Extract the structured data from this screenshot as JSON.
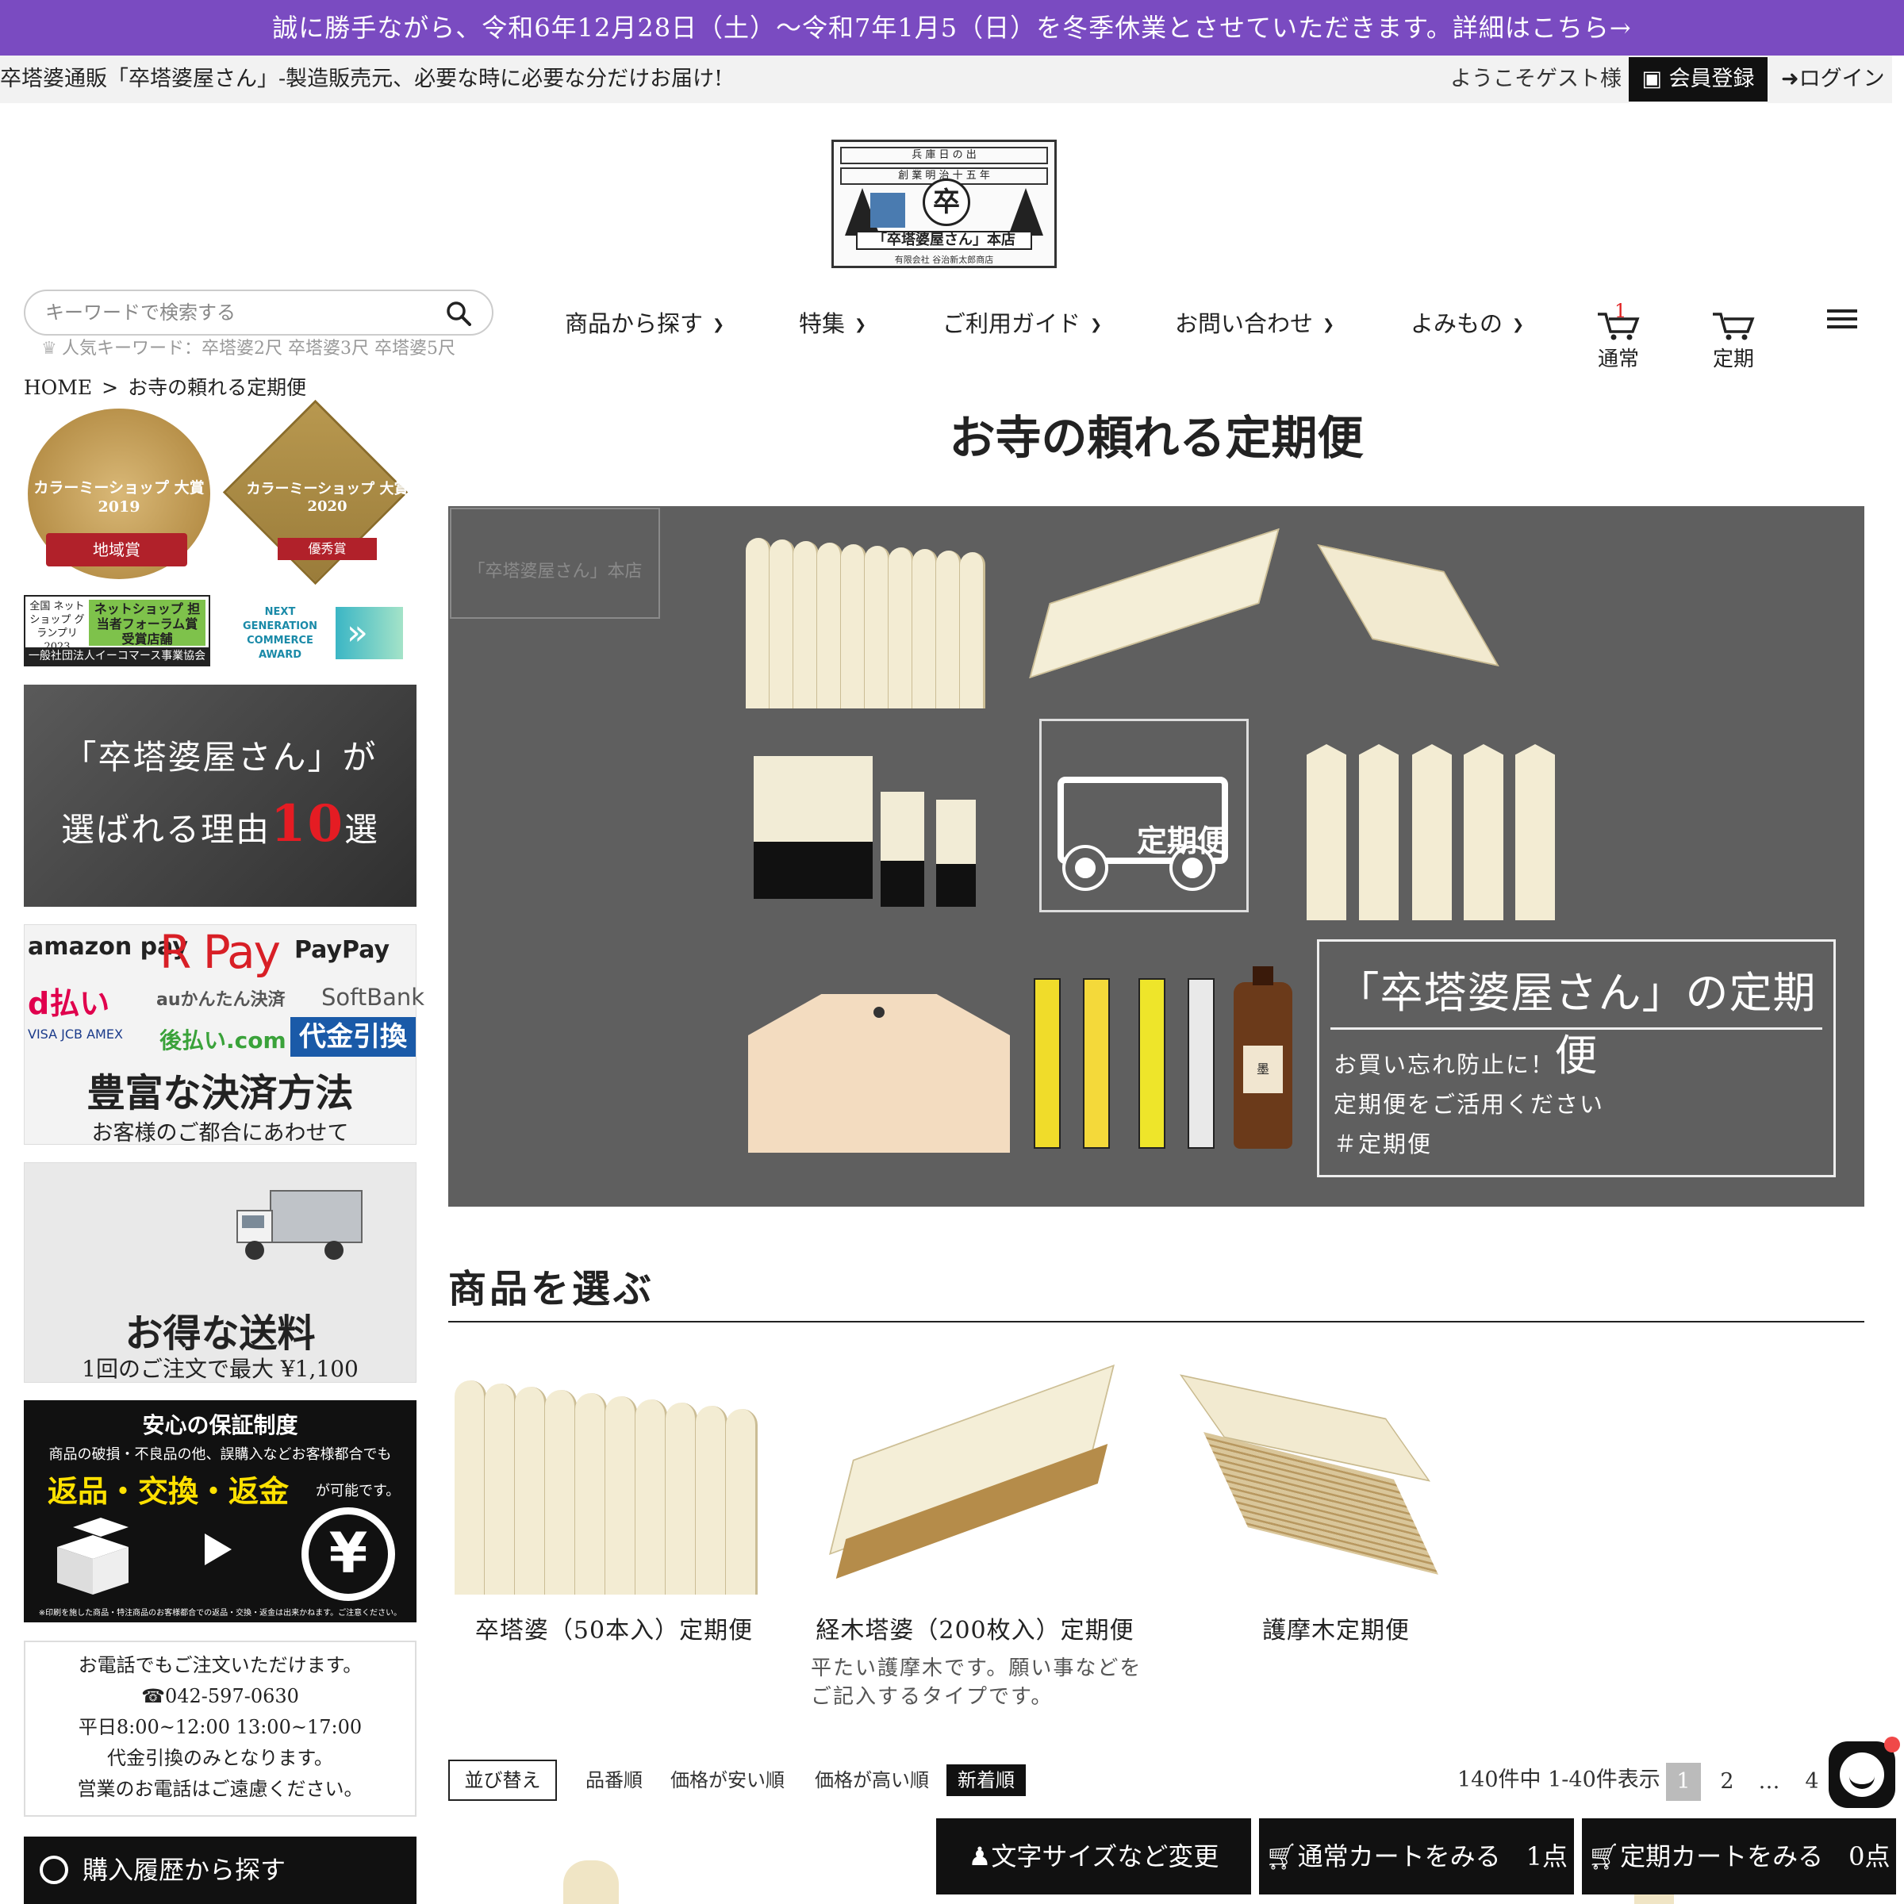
{
  "announcement": "誠に勝手ながら、令和6年12月28日（土）〜令和7年1月5（日）を冬季休業とさせていただきます。詳細はこちら→",
  "utilbar": {
    "tagline": "卒塔婆通販「卒塔婆屋さん」-製造販売元、必要な時に必要な分だけお届け!",
    "welcome": "ようこそゲスト様",
    "register": "会員登録",
    "login": "ログイン"
  },
  "logo": {
    "line1": "兵 庫 日 の 出",
    "line2": "創 業 明 治 十 五 年",
    "mark": "卒",
    "name": "「卒塔婆屋さん」本店",
    "company": "有限会社 谷治新太郎商店"
  },
  "search": {
    "placeholder": "キーワードで検索する",
    "popular_label": "人気キーワード：",
    "popular_keywords": "卒塔婆2尺 卒塔婆3尺 卒塔婆5尺"
  },
  "nav": {
    "items": [
      "商品から探す",
      "特集",
      "ご利用ガイド",
      "お問い合わせ",
      "よみもの"
    ],
    "cart_normal": "通常",
    "cart_normal_count": "1",
    "cart_subscription": "定期"
  },
  "breadcrumb": {
    "home": "HOME",
    "sep": ">",
    "current": "お寺の頼れる定期便"
  },
  "sidebar": {
    "award1_title": "カラーミーショップ 大賞2019",
    "award1_ribbon": "地域賞",
    "award2_title": "カラーミーショップ 大賞2020",
    "award2_ribbon": "優秀賞",
    "grandprix_left": "全国 ネットショップ グランプリ 2023",
    "grandprix_right": "ネットショップ 担当者フォーラム賞 受賞店舗",
    "grandprix_bottom": "一般社団法人イーコマース事業協会",
    "nextgen": "NEXT GENERATION COMMERCE AWARD",
    "reason_line1": "「卒塔婆屋さん」が",
    "reason_line2_pre": "選ばれる理由",
    "reason_num": "10",
    "reason_line2_post": "選",
    "pay_amazon": "amazon pay",
    "pay_r": "R Pay",
    "pay_paypay": "PayPay",
    "pay_d": "d払い",
    "pay_au": "auかんたん決済",
    "pay_softbank": "SoftBank",
    "pay_cards": "VISA JCB AMEX",
    "pay_atobarai": "後払い.com",
    "pay_cod": "代金引換",
    "pay_title": "豊富な決済方法",
    "pay_sub": "お客様のご都合にあわせて",
    "ship_title": "お得な送料",
    "ship_sub": "1回のご注文で最大 ¥1,100",
    "guar_title": "安心の保証制度",
    "guar_sub": "商品の破損・不良品の他、誤購入などお客様都合でも",
    "guar_big": "返品・交換・返金",
    "guar_tail": "が可能です。",
    "guar_note": "※印刷を施した商品・特注商品のお客様都合での返品・交換・返金は出来かねます。ご注意ください。",
    "phone_lines": [
      "お電話でもご注文いただけます。",
      "☎042-597-0630",
      "平日8:00~12:00 13:00~17:00",
      "代金引換のみとなります。",
      "営業のお電話はご遠慮ください。"
    ],
    "history": "購入履歴から探す"
  },
  "main": {
    "title": "お寺の頼れる定期便",
    "hero_truck_label": "定期便",
    "hero_caption": "「卒塔婆屋さん」の定期便",
    "hero_lines": [
      "お買い忘れ防止に！",
      "定期便をご活用ください",
      "＃定期便"
    ],
    "section_heading": "商品を選ぶ",
    "products": [
      {
        "name": "卒塔婆（50本入）定期便",
        "desc": ""
      },
      {
        "name": "経木塔婆（200枚入）定期便",
        "desc": "平たい護摩木です。願い事などをご記入するタイプです。"
      },
      {
        "name": "護摩木定期便",
        "desc": ""
      }
    ],
    "sort": {
      "label": "並び替え",
      "options": [
        "品番順",
        "価格が安い順",
        "価格が高い順",
        "新着順"
      ],
      "active": "新着順",
      "count": "140件中 1-40件表示",
      "pages": [
        "1",
        "2",
        "…",
        "4"
      ]
    }
  },
  "fixed": {
    "font_size": "文字サイズなど変更",
    "cart_normal": "通常カートをみる　1点",
    "cart_sub": "定期カートをみる　0点"
  },
  "colors": {
    "announcement_bg": "#7a4bc1",
    "accent_red": "#e51c23",
    "dark": "#111111"
  }
}
